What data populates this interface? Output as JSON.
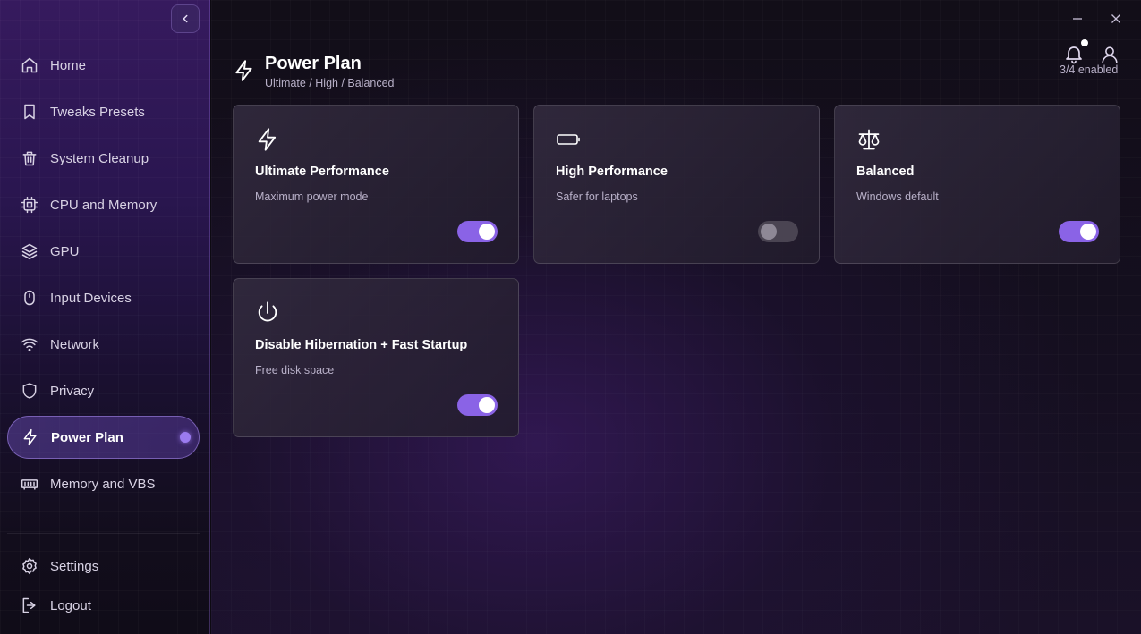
{
  "sidebar": {
    "items": [
      {
        "label": "Home",
        "icon": "home-icon",
        "active": false
      },
      {
        "label": "Tweaks Presets",
        "icon": "bookmark-icon",
        "active": false
      },
      {
        "label": "System Cleanup",
        "icon": "trash-icon",
        "active": false
      },
      {
        "label": "CPU and Memory",
        "icon": "cpu-icon",
        "active": false
      },
      {
        "label": "GPU",
        "icon": "layers-icon",
        "active": false
      },
      {
        "label": "Input Devices",
        "icon": "mouse-icon",
        "active": false
      },
      {
        "label": "Network",
        "icon": "wifi-icon",
        "active": false
      },
      {
        "label": "Privacy",
        "icon": "shield-icon",
        "active": false
      },
      {
        "label": "Power Plan",
        "icon": "zap-icon",
        "active": true
      },
      {
        "label": "Memory and VBS",
        "icon": "memory-icon",
        "active": false
      }
    ],
    "bottom_items": [
      {
        "label": "Settings",
        "icon": "gear-icon"
      },
      {
        "label": "Logout",
        "icon": "logout-icon"
      }
    ]
  },
  "header": {
    "title": "Power Plan",
    "subtitle": "Ultimate / High / Balanced",
    "enabled_count": "3/4 enabled"
  },
  "cards": [
    {
      "title": "Ultimate Performance",
      "description": "Maximum power mode",
      "icon": "zap-icon",
      "enabled": true
    },
    {
      "title": "High Performance",
      "description": "Safer for laptops",
      "icon": "battery-icon",
      "enabled": false
    },
    {
      "title": "Balanced",
      "description": "Windows default",
      "icon": "scale-icon",
      "enabled": true
    },
    {
      "title": "Disable Hibernation + Fast Startup",
      "description": "Free disk space",
      "icon": "power-icon",
      "enabled": true
    }
  ],
  "colors": {
    "accent": "#8a63e6",
    "active_dot": "#9b7bf0",
    "toggle_off": "#4a4452"
  }
}
